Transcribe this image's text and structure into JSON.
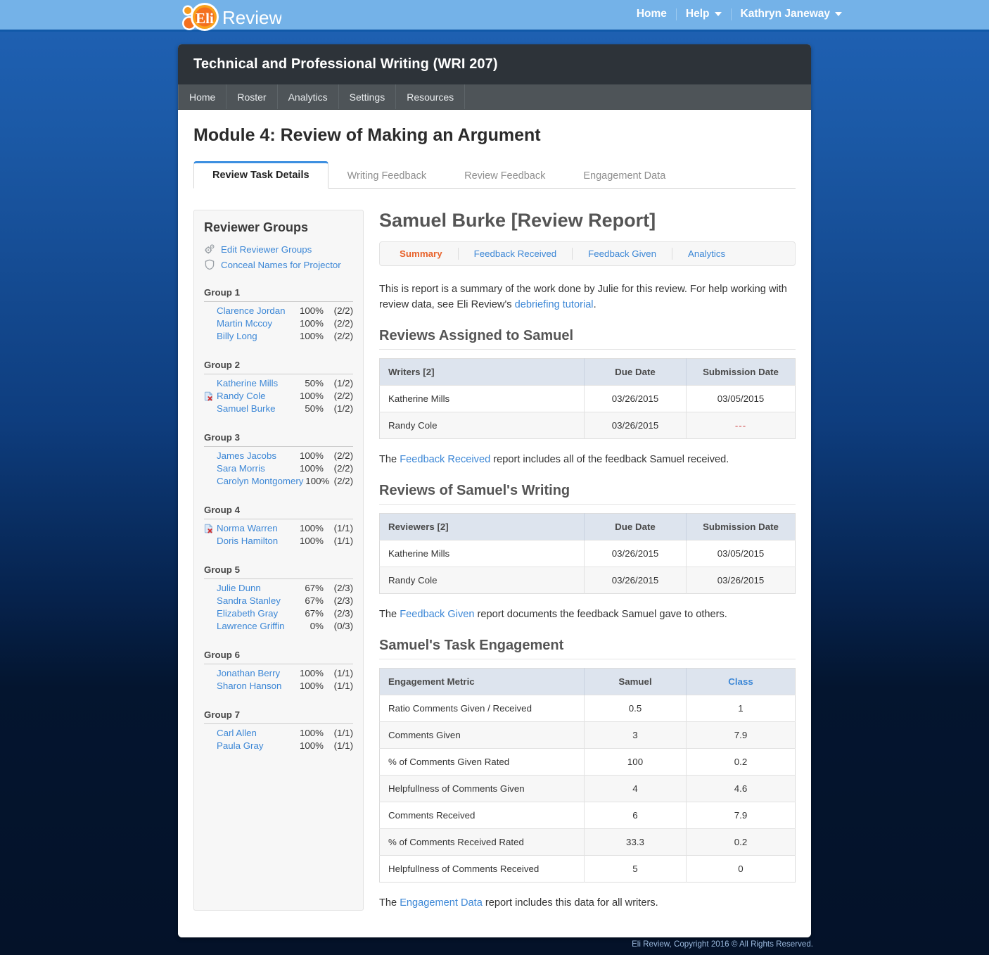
{
  "topnav": {
    "home": "Home",
    "help": "Help",
    "user": "Kathryn Janeway",
    "logo_text": "Review",
    "logo_mark": "Eli"
  },
  "course": {
    "title": "Technical and Professional Writing (WRI 207)",
    "nav": [
      "Home",
      "Roster",
      "Analytics",
      "Settings",
      "Resources"
    ]
  },
  "page": {
    "title": "Module 4: Review of Making an Argument",
    "tabs": [
      {
        "label": "Review Task Details",
        "active": true
      },
      {
        "label": "Writing Feedback",
        "active": false
      },
      {
        "label": "Review Feedback",
        "active": false
      },
      {
        "label": "Engagement Data",
        "active": false
      }
    ]
  },
  "sidebar": {
    "heading": "Reviewer Groups",
    "links": [
      {
        "label": "Edit Reviewer Groups",
        "icon": "cogs-icon"
      },
      {
        "label": "Conceal Names for Projector",
        "icon": "shield-icon"
      }
    ],
    "groups": [
      {
        "name": "Group 1",
        "members": [
          {
            "name": "Clarence Jordan",
            "percent": "100%",
            "fraction": "(2/2)",
            "flag": false
          },
          {
            "name": "Martin Mccoy",
            "percent": "100%",
            "fraction": "(2/2)",
            "flag": false
          },
          {
            "name": "Billy Long",
            "percent": "100%",
            "fraction": "(2/2)",
            "flag": false
          }
        ]
      },
      {
        "name": "Group 2",
        "members": [
          {
            "name": "Katherine Mills",
            "percent": "50%",
            "fraction": "(1/2)",
            "flag": false
          },
          {
            "name": "Randy Cole",
            "percent": "100%",
            "fraction": "(2/2)",
            "flag": true
          },
          {
            "name": "Samuel Burke",
            "percent": "50%",
            "fraction": "(1/2)",
            "flag": false
          }
        ]
      },
      {
        "name": "Group 3",
        "members": [
          {
            "name": "James Jacobs",
            "percent": "100%",
            "fraction": "(2/2)",
            "flag": false
          },
          {
            "name": "Sara Morris",
            "percent": "100%",
            "fraction": "(2/2)",
            "flag": false
          },
          {
            "name": "Carolyn Montgomery",
            "percent": "100%",
            "fraction": "(2/2)",
            "flag": false
          }
        ]
      },
      {
        "name": "Group 4",
        "members": [
          {
            "name": "Norma Warren",
            "percent": "100%",
            "fraction": "(1/1)",
            "flag": true
          },
          {
            "name": "Doris Hamilton",
            "percent": "100%",
            "fraction": "(1/1)",
            "flag": false
          }
        ]
      },
      {
        "name": "Group 5",
        "members": [
          {
            "name": "Julie Dunn",
            "percent": "67%",
            "fraction": "(2/3)",
            "flag": false
          },
          {
            "name": "Sandra Stanley",
            "percent": "67%",
            "fraction": "(2/3)",
            "flag": false
          },
          {
            "name": "Elizabeth Gray",
            "percent": "67%",
            "fraction": "(2/3)",
            "flag": false
          },
          {
            "name": "Lawrence Griffin",
            "percent": "0%",
            "fraction": "(0/3)",
            "flag": false
          }
        ]
      },
      {
        "name": "Group 6",
        "members": [
          {
            "name": "Jonathan Berry",
            "percent": "100%",
            "fraction": "(1/1)",
            "flag": false
          },
          {
            "name": "Sharon Hanson",
            "percent": "100%",
            "fraction": "(1/1)",
            "flag": false
          }
        ]
      },
      {
        "name": "Group 7",
        "members": [
          {
            "name": "Carl Allen",
            "percent": "100%",
            "fraction": "(1/1)",
            "flag": false
          },
          {
            "name": "Paula Gray",
            "percent": "100%",
            "fraction": "(1/1)",
            "flag": false
          }
        ]
      }
    ]
  },
  "report": {
    "title": "Samuel Burke [Review Report]",
    "subtabs": [
      {
        "label": "Summary",
        "active": true
      },
      {
        "label": "Feedback Received",
        "active": false
      },
      {
        "label": "Feedback Given",
        "active": false
      },
      {
        "label": "Analytics",
        "active": false
      }
    ],
    "intro_before": "This is report is a summary of the work done by Julie for this review. For help working with review data, see Eli Review's ",
    "intro_link": "debriefing tutorial",
    "intro_after": ".",
    "assigned": {
      "heading": "Reviews Assigned to Samuel",
      "columns": [
        "Writers [2]",
        "Due Date",
        "Submission Date"
      ],
      "rows": [
        [
          "Katherine Mills",
          "03/26/2015",
          "03/05/2015"
        ],
        [
          "Randy Cole",
          "03/26/2015",
          "---"
        ]
      ],
      "note_before": "The ",
      "note_link": "Feedback Received",
      "note_after": " report includes all of the feedback Samuel received."
    },
    "reviews_of": {
      "heading": "Reviews of Samuel's Writing",
      "columns": [
        "Reviewers [2]",
        "Due Date",
        "Submission Date"
      ],
      "rows": [
        [
          "Katherine Mills",
          "03/26/2015",
          "03/05/2015"
        ],
        [
          "Randy Cole",
          "03/26/2015",
          "03/26/2015"
        ]
      ],
      "note_before": "The ",
      "note_link": "Feedback Given",
      "note_after": " report documents the feedback Samuel gave to others."
    },
    "engagement": {
      "heading": "Samuel's Task Engagement",
      "columns": [
        "Engagement Metric",
        "Samuel",
        "Class"
      ],
      "rows": [
        [
          "Ratio Comments Given / Received",
          "0.5",
          "1"
        ],
        [
          "Comments Given",
          "3",
          "7.9"
        ],
        [
          "% of Comments Given Rated",
          "100",
          "0.2"
        ],
        [
          "Helpfullness of Comments Given",
          "4",
          "4.6"
        ],
        [
          "Comments Received",
          "6",
          "7.9"
        ],
        [
          "% of Comments Received Rated",
          "33.3",
          "0.2"
        ],
        [
          "Helpfullness of Comments Received",
          "5",
          "0"
        ]
      ],
      "note_before": "The ",
      "note_link": "Engagement Data",
      "note_after": " report includes this data for all writers."
    }
  },
  "footer": {
    "text": "Eli Review, Copyright 2016 © All Rights Reserved."
  },
  "colors": {
    "accent_blue": "#3c87d6",
    "accent_orange": "#e8632c",
    "header_dark": "#2d3339",
    "topbar_blue": "#74b2e8"
  }
}
